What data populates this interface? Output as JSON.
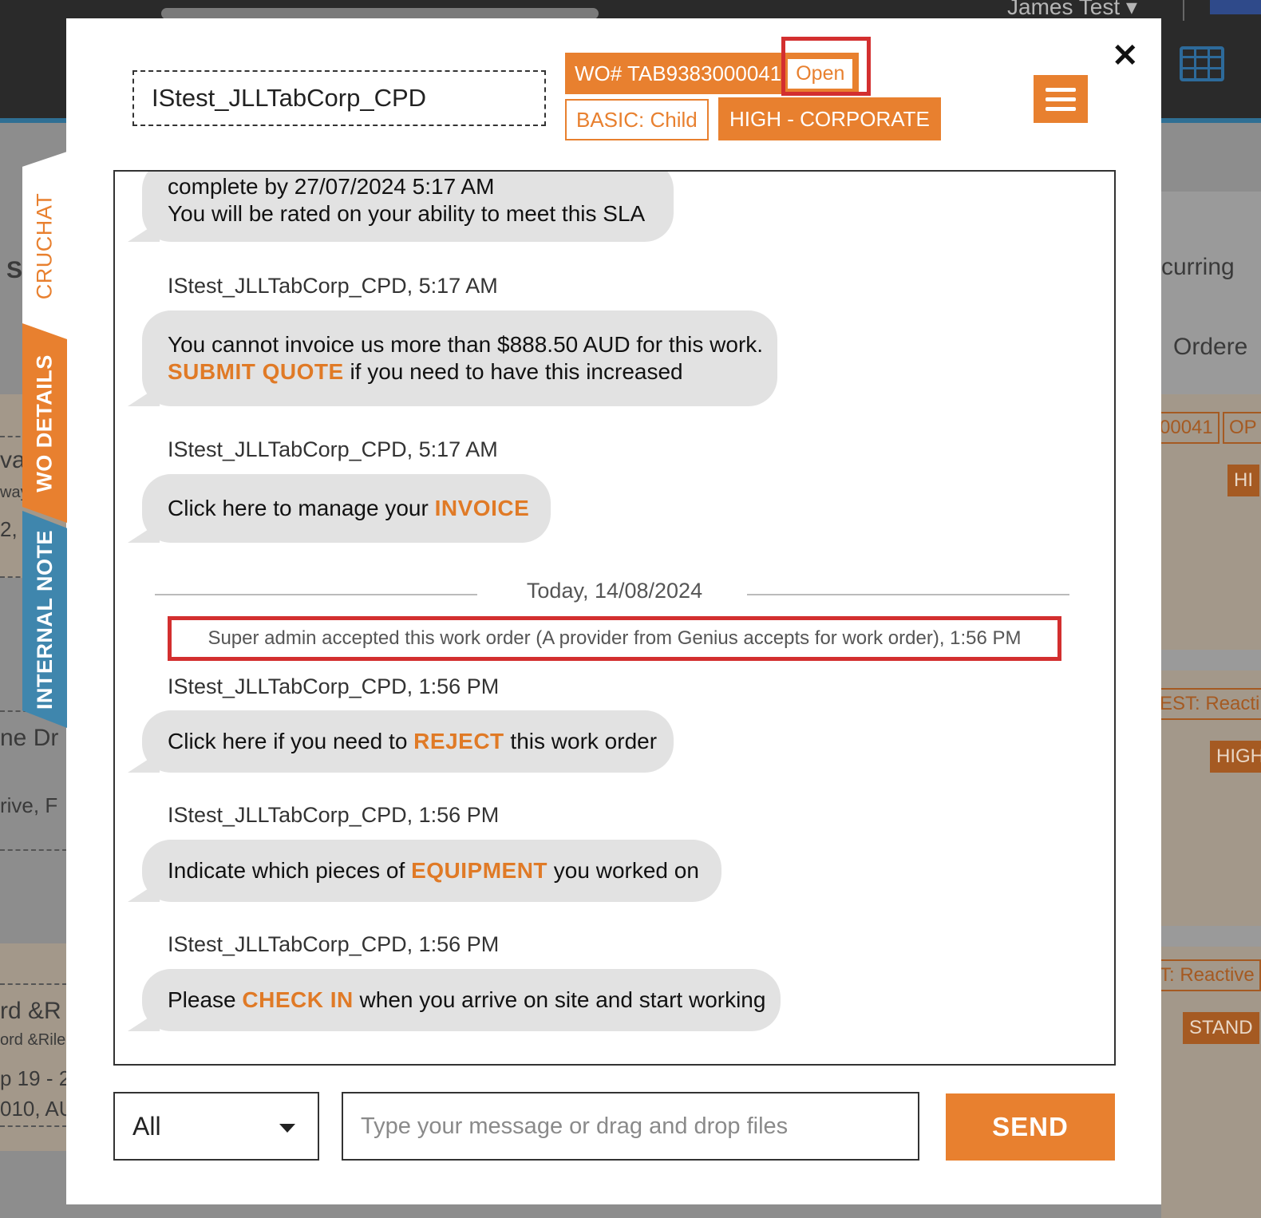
{
  "background": {
    "user_name": "James Test ▾",
    "right_texts": [
      "curring",
      "Ordere"
    ],
    "right_tags": [
      "00041",
      "OP",
      "HI",
      "EST: Reacti",
      "HIGH",
      "T: Reactive",
      "STAND"
    ],
    "left_texts": [
      "S",
      "va",
      "way",
      "2,",
      "ne Dr",
      "rive, F",
      "rd &R",
      "ord &Rile",
      "p 19 - 2",
      "010, AU"
    ]
  },
  "modal": {
    "title": "IStest_JLLTabCorp_CPD",
    "wo_number": "WO# TAB9383000041",
    "status": "Open",
    "type_badge": "BASIC: Child",
    "priority_badge": "HIGH - CORPORATE",
    "close_label": "✕"
  },
  "side_tabs": {
    "cruchat": "CRUCHAT",
    "wo_details": "WO DETAILS",
    "internal_note": "INTERNAL NOTE"
  },
  "chat": {
    "messages": [
      {
        "lines": [
          "complete by 27/07/2024 5:17 AM",
          "You will be rated on your ability to meet this SLA"
        ]
      },
      {
        "sender": "IStest_JLLTabCorp_CPD, 5:17 AM",
        "line1": "You cannot invoice us more than $888.50 AUD for this work.",
        "keyword": "SUBMIT QUOTE",
        "after": " if you need to have this increased"
      },
      {
        "sender": "IStest_JLLTabCorp_CPD, 5:17 AM",
        "before": "Click here to manage your ",
        "keyword": "INVOICE",
        "after": ""
      },
      {
        "sender": "IStest_JLLTabCorp_CPD, 1:56 PM",
        "before": "Click here if you need to ",
        "keyword": "REJECT",
        "after": " this work order"
      },
      {
        "sender": "IStest_JLLTabCorp_CPD, 1:56 PM",
        "before": "Indicate which pieces of ",
        "keyword": "EQUIPMENT",
        "after": " you worked on"
      },
      {
        "sender": "IStest_JLLTabCorp_CPD, 1:56 PM",
        "before": "Please ",
        "keyword": "CHECK IN",
        "after": " when you arrive on site and start working"
      }
    ],
    "date_separator": "Today, 14/08/2024",
    "system_message": "Super admin accepted this work order (A provider from Genius accepts for work order), 1:56 PM"
  },
  "composer": {
    "filter_value": "All",
    "input_placeholder": "Type your message or drag and drop files",
    "send_label": "SEND"
  },
  "colors": {
    "accent": "#e8802f",
    "keyword": "#e07a26",
    "highlight": "#d32f2f",
    "note_tab": "#3f86ad"
  }
}
